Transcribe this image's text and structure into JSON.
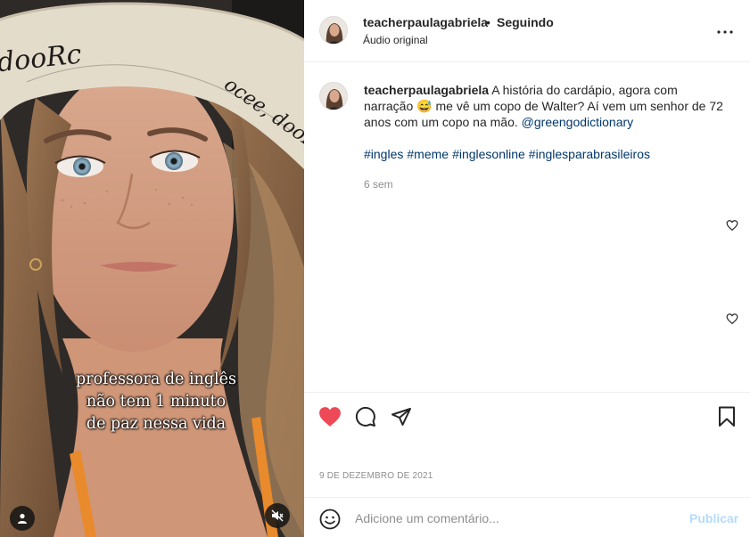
{
  "media": {
    "hat_text_top": "dooRc",
    "hat_text_brim": "ocee, dooR",
    "overlay_lines": [
      "professora de inglês",
      "não tem 1 minuto",
      "de paz nessa vida"
    ],
    "user_tag_icon": "person-icon",
    "mute_icon": "speaker-muted-icon"
  },
  "header": {
    "username": "teacherpaulagabriela",
    "separator": "•",
    "follow_status": "Seguindo",
    "audio_label": "Áudio original",
    "more_icon": "more-horizontal-icon"
  },
  "caption": {
    "username": "teacherpaulagabriela",
    "text_before_emoji": "A história do cardápio, agora com narração",
    "emoji": "😅",
    "text_after_emoji": "me vê um copo de Walter? Aí vem um senhor de 72 anos com um copo na mão.",
    "mention": "@greengodictionary",
    "hashtags": [
      "#ingles",
      "#meme",
      "#inglesonline",
      "#inglesparabrasileiros"
    ],
    "time_ago": "6 sem"
  },
  "actions": {
    "like_icon": "heart-filled-icon",
    "comment_icon": "comment-bubble-icon",
    "share_icon": "paper-plane-icon",
    "save_icon": "bookmark-icon",
    "liked_color": "#ed4956",
    "post_date": "9 de dezembro de 2021"
  },
  "add_comment": {
    "emoji_icon": "smiley-icon",
    "placeholder": "Adicione um comentário...",
    "publish_label": "Publicar",
    "publish_color": "#b3dbff"
  }
}
